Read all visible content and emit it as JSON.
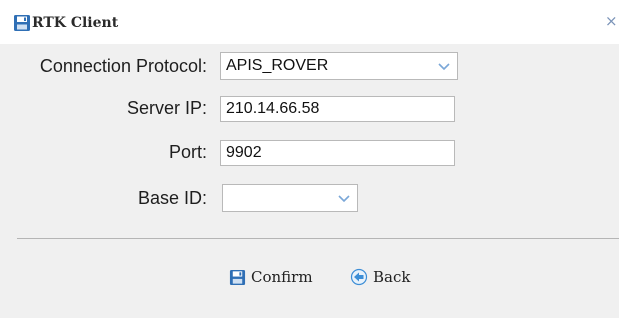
{
  "window": {
    "title": "RTK Client",
    "close_glyph": "×",
    "title_icon": "save-icon"
  },
  "form": {
    "protocol": {
      "label": "Connection Protocol:",
      "value": "APIS_ROVER"
    },
    "server_ip": {
      "label": "Server IP:",
      "value": "210.14.66.58"
    },
    "port": {
      "label": "Port:",
      "value": "9902"
    },
    "base_id": {
      "label": "Base ID:",
      "value": ""
    }
  },
  "footer": {
    "confirm_label": "Confirm",
    "back_label": "Back",
    "confirm_icon": "save-icon",
    "back_icon": "back-arrow-icon"
  },
  "colors": {
    "accent_blue": "#2f6fb5",
    "back_icon_blue": "#3d8ed6"
  }
}
